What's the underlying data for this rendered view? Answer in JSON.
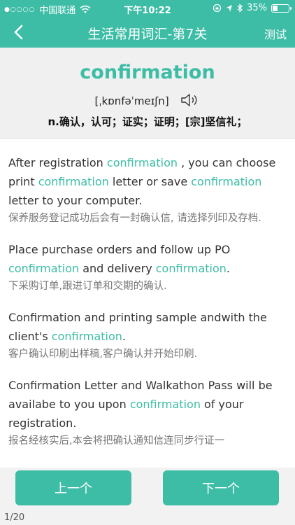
{
  "status_bar": {
    "carrier": "中国联通",
    "time": "下午10:22",
    "battery": "35%",
    "battery_level": 0.35
  },
  "nav": {
    "title": "生活常用词汇-第7关",
    "action_label": "测试",
    "back_icon": "chevron-left-icon"
  },
  "word": {
    "term": "confirmation",
    "phonetic": "[ˌkɒnfəˈmeɪʃn]",
    "definition": "n.确认，认可；证实；证明；[宗]坚信礼；"
  },
  "examples": [
    {
      "en": [
        "After registration ",
        "confirmation",
        " , you can choose print ",
        "confirmation",
        " letter or save ",
        "confirmation",
        " letter to your computer."
      ],
      "zh": "保养服务登记成功后会有一封确认信, 请选择列印及存档."
    },
    {
      "en": [
        "Place purchase orders and follow up PO ",
        "confirmation",
        " and delivery ",
        "confirmation",
        "."
      ],
      "zh": "下采购订单,跟进订单和交期的确认."
    },
    {
      "en": [
        "Confirmation and printing sample andwith the client's ",
        "confirmation",
        "."
      ],
      "zh": "客户确认印刷出样稿,客户确认并开始印刷."
    },
    {
      "en": [
        "Confirmation Letter and Walkathon Pass will be availabe to you upon ",
        "confirmation",
        " of your registration."
      ],
      "zh": "报名经核实后,本会将把确认通知信连同步行证一"
    }
  ],
  "footer": {
    "prev_label": "上一个",
    "next_label": "下一个",
    "page_count": "1/20"
  },
  "colors": {
    "accent": "#3dbda6"
  }
}
